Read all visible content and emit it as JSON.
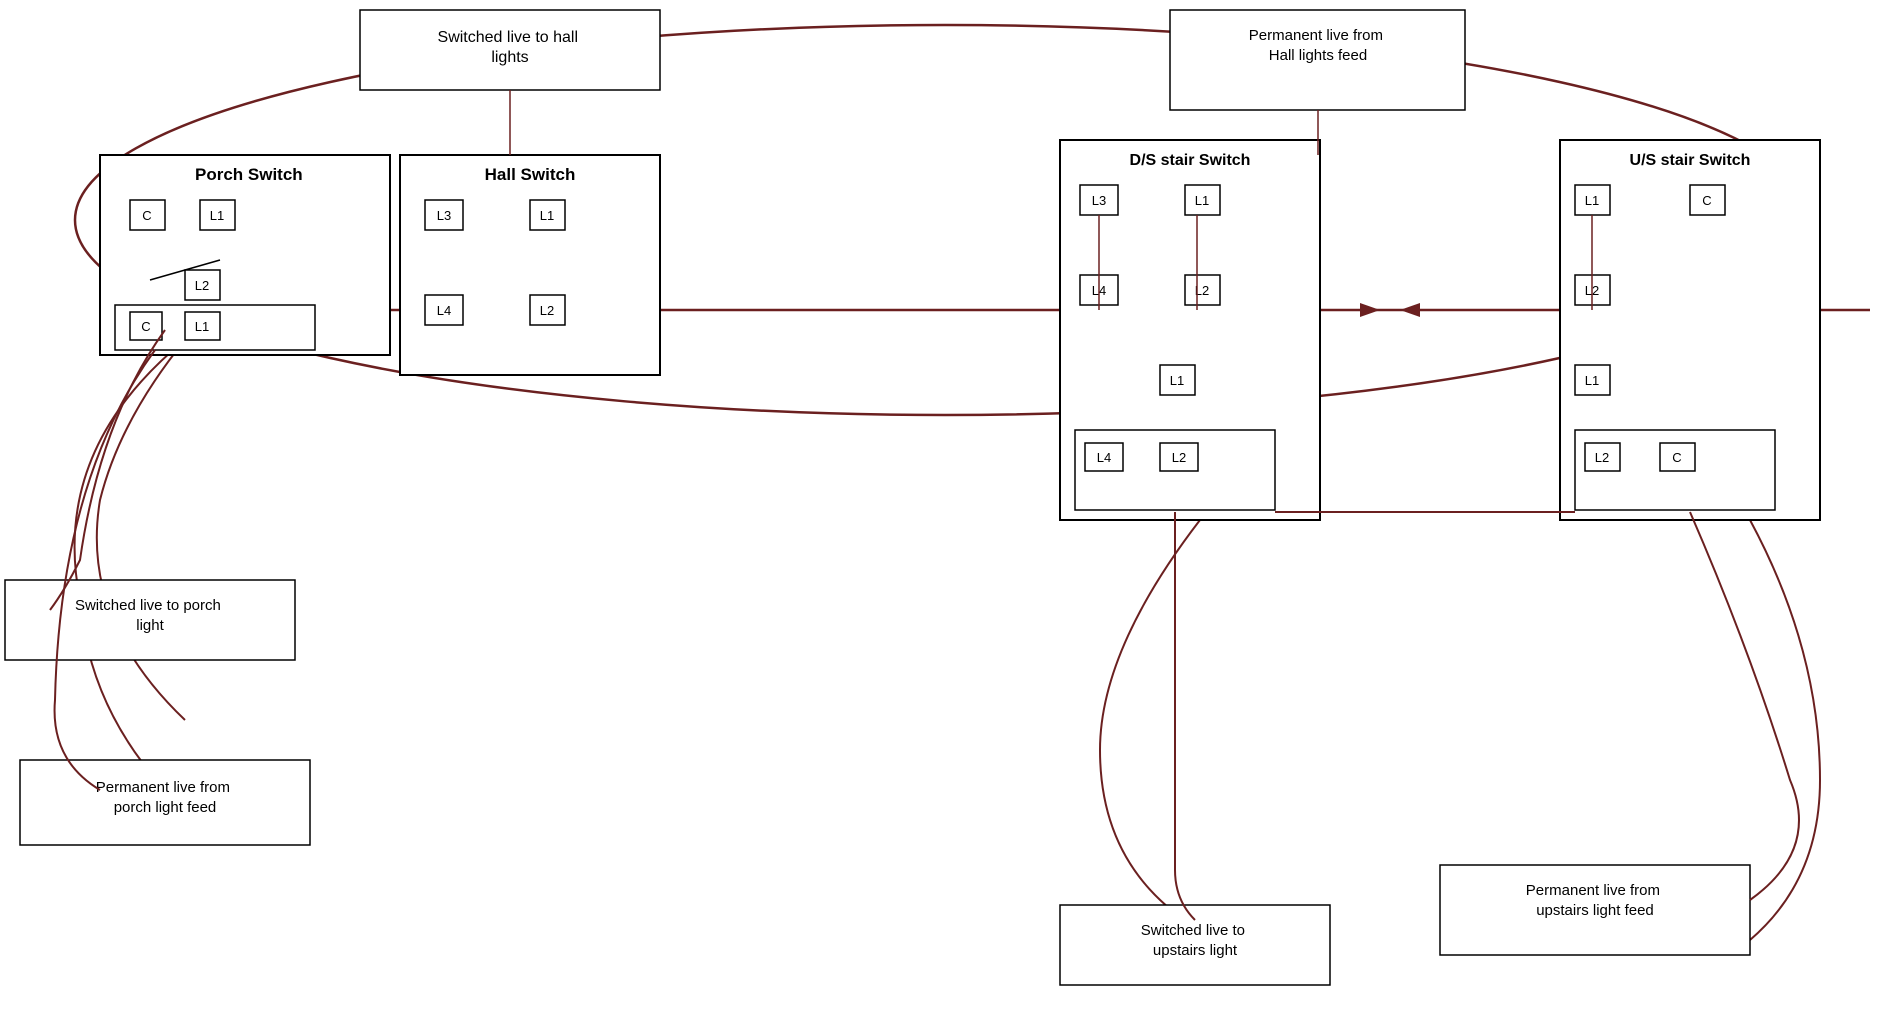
{
  "labels": {
    "switched_live_hall": "Switched live to hall lights",
    "permanent_live_hall": "Permanent live from Hall lights feed",
    "porch_switch": "Porch Switch",
    "hall_switch": "Hall Switch",
    "ds_stair_switch": "D/S stair Switch",
    "us_stair_switch": "U/S stair Switch",
    "switched_live_porch": "Switched live to porch light",
    "permanent_live_porch": "Permanent live from porch light feed",
    "switched_live_upstairs": "Switched live to upstairs light",
    "permanent_live_upstairs": "Permanent live from upstairs light feed"
  },
  "colors": {
    "wire": "#6B2020",
    "box_border": "#000000",
    "background": "#ffffff",
    "text": "#000000"
  }
}
